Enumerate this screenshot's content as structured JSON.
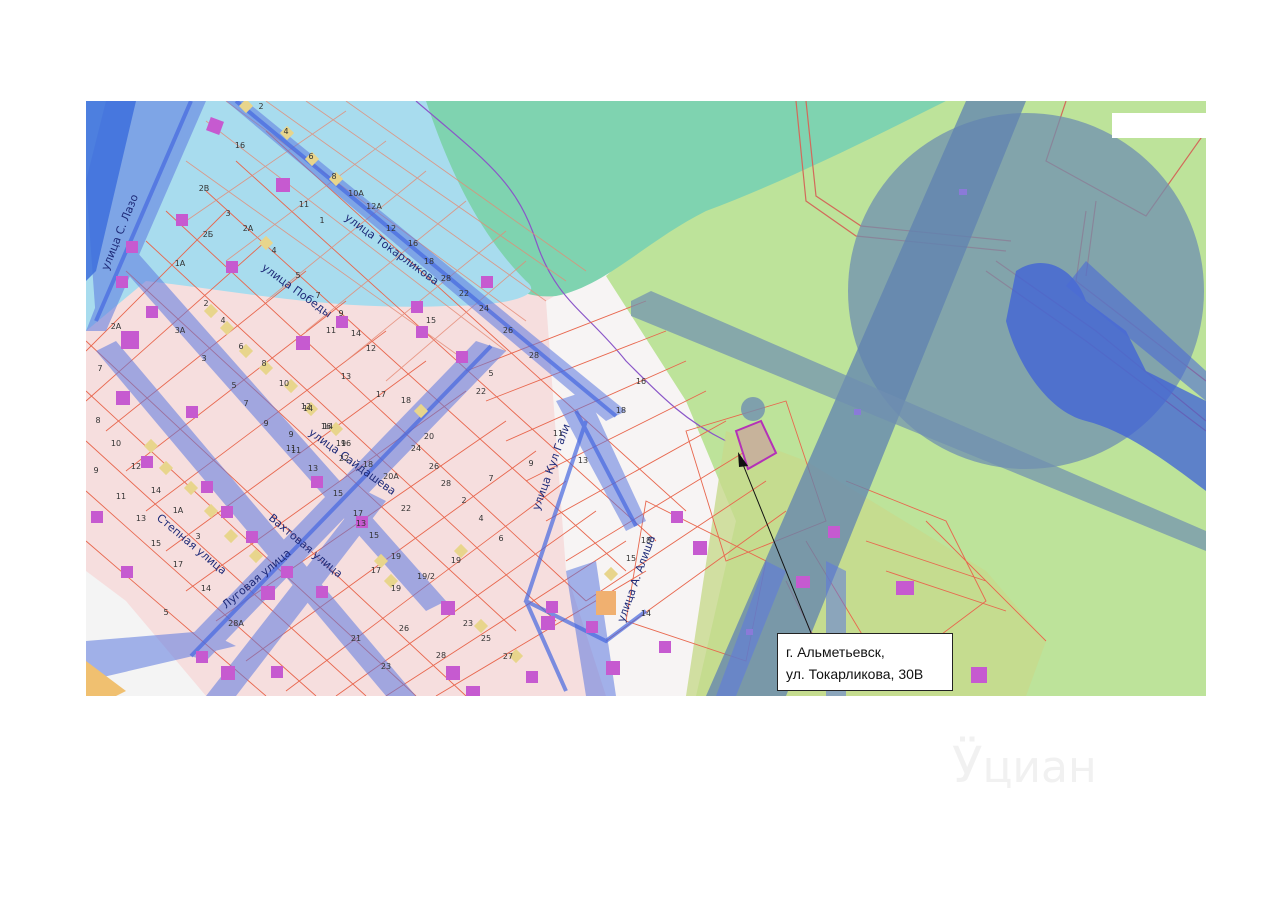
{
  "callout": {
    "line1": "г. Альметьевск,",
    "line2": "ул. Токарликова, 30В"
  },
  "watermark": {
    "glyph": "Ӱ",
    "text": "циан"
  },
  "streets": [
    "улица Токарликова",
    "улица Победы",
    "улица С. Лазо",
    "улица Сайдашева",
    "Вахтовая улица",
    "Степная улица",
    "Луговая улица",
    "улица Кул Гали",
    "улица А. Алиша"
  ],
  "plot_numbers": [
    "2",
    "4",
    "16",
    "6",
    "8",
    "10А",
    "12А",
    "12",
    "16",
    "18",
    "28",
    "22",
    "24",
    "26",
    "28",
    "2В",
    "2А",
    "4",
    "5",
    "7",
    "9",
    "11",
    "1",
    "3",
    "2Б",
    "1А",
    "2А",
    "3А",
    "2",
    "4",
    "6",
    "8",
    "10",
    "12",
    "14",
    "16",
    "18",
    "3",
    "5",
    "7",
    "9",
    "11",
    "13",
    "15",
    "17",
    "19",
    "20А",
    "22",
    "19/2",
    "23",
    "25",
    "27",
    "13",
    "15",
    "17",
    "19",
    "21",
    "23",
    "26",
    "28",
    "11",
    "14",
    "12",
    "9",
    "11",
    "13",
    "14",
    "15",
    "16",
    "17",
    "18",
    "19",
    "20",
    "22",
    "24",
    "26",
    "28",
    "2",
    "4",
    "6",
    "8",
    "10",
    "12",
    "14",
    "1А",
    "3",
    "5",
    "7",
    "9",
    "11",
    "13",
    "15",
    "17",
    "14",
    "28А",
    "19",
    "22",
    "5",
    "7",
    "9",
    "11",
    "13",
    "15",
    "18",
    "14",
    "16",
    "18"
  ],
  "colors": {
    "residential_zone": "#f6dede",
    "water_protection_zone": "#a8dcee",
    "forest_zone": "#7fd3b0",
    "green_zone": "#bde39a",
    "buffer_zone": "#6f8fb0",
    "road_corridor": "#7b86e6",
    "highway": "#3d6fdc",
    "parcel_line": "#e8674e",
    "building": "#c65ad0",
    "plot_marker": "#e8d58c",
    "target_parcel": "#c7b39b",
    "target_outline": "#b431b8"
  }
}
